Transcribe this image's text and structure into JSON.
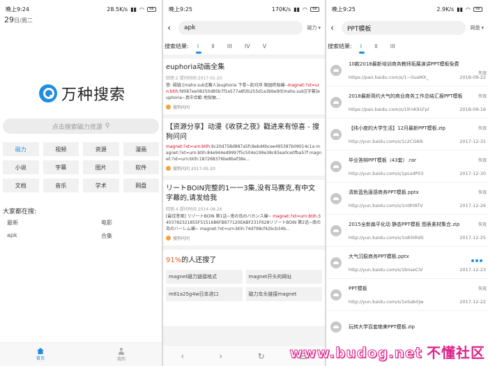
{
  "phone1": {
    "status": {
      "time": "晚上9:24",
      "speed": "28.5K/s",
      "battery": "66"
    },
    "date": {
      "day": "29",
      "weekday": "日/周二"
    },
    "brand": "万种搜索",
    "search_placeholder": "点击搜索磁力资源",
    "categories": [
      "磁力",
      "视频",
      "资源",
      "漫画",
      "小说",
      "字幕",
      "图片",
      "软件",
      "文档",
      "音乐",
      "学术",
      "网盘"
    ],
    "hot_title": "大家都在搜:",
    "hot_items": [
      "最新",
      "电影",
      "apk",
      "合集"
    ],
    "nav": {
      "home": "首页",
      "mine": "我的"
    }
  },
  "phone2": {
    "status": {
      "time": "晚上9:25",
      "speed": "170K/s",
      "battery": "66"
    },
    "query": "apk",
    "engine": "磁力",
    "tabs_label": "搜索结果:",
    "tabs": [
      "I",
      "II",
      "III",
      "IV",
      "V"
    ],
    "results": [
      {
        "title": "euphoria动画全集",
        "meta": "回答:2  提问时间:2017-01-20",
        "snippet_a": "答: 磁链:[maho.sub][魔人]euphoria 下卷~凯刈冲 案园终局编--",
        "snippet_hl": "magnet:?xt=urn:btih:",
        "snippet_b": "fd087ee08250d85b7f1e577a8f2b255d1a3bbe90[maho.sub][字幕]euphoria~真中合歓 地狱抽...",
        "source": "搜狗问问"
      },
      {
        "title": "【资源分享】动漫《收获之夜》戳进来有惊喜 - 搜狗问问",
        "meta": "",
        "snippet_a": "",
        "snippet_hl": "magnet:?xt=urn:btih:",
        "snippet_b": "6c20d758d887a5fc8ebd4bcee495387b09014c1a magnet:?xt=urn:btih:84e944ed9997f5c504e199e38c83ea0ce0fba57f magnet:?xt=urn:btih:187268376be8baf38e...",
        "source": "搜狗问问  2017-05-20"
      },
      {
        "title": "リートBOIN完整的1一一3集,没有马赛克,有中文字幕的,请发给我",
        "meta": "回答:4  提问时间:2014-08-26",
        "snippet_a": "[最佳答案] リゾートBOIN 第1话~南の岛のバカンス编~ ",
        "snippet_hl": "magnet:?xt=urn:btih:",
        "snippet_b": "3403782321855F5151686FB877120EABF231F628リゾートBOIN 第2话~南の岛のハーレム编~ magnet:?xt=urn:btih:74d798cf42bcb34b...",
        "source": "搜狗问问"
      }
    ],
    "others": {
      "percent": "91%",
      "text": "的人还搜了",
      "chips": [
        "magnet磁力链接格式",
        "magnet开头的网址",
        "m81a25g4w日本进口",
        "磁力车头链接magnet"
      ]
    },
    "browser_nav": [
      "‹",
      "›",
      "↻",
      "☰"
    ]
  },
  "phone3": {
    "status": {
      "time": "晚上9:25",
      "speed": "2.9K/s",
      "battery": "66"
    },
    "query": "PPT模板",
    "engine": "网盘",
    "tabs_label": "搜索结果:",
    "tabs": [
      "I",
      "II",
      "III"
    ],
    "items": [
      {
        "title": "10款2018最新培训商务教师拓展演讲PPT模板免费",
        "url": "https://pan.baidu.com/s/1~0uaMX_",
        "date": "2018-09-22",
        "status": "失效"
      },
      {
        "title": "2018最新简约大气的商业商务工作总结汇报PPT模板",
        "url": "https://pan.baidu.com/s/1lFnK91Fpl",
        "date": "2018-09-16",
        "status": "失效"
      },
      {
        "title": "【纬小度的大学生活】12月最新PPT模板.zip",
        "url": "http://yun.baidu.com/s/1c2CG6lk",
        "date": "2017-12-31",
        "status": "失效"
      },
      {
        "title": "毕业答辩PPT模板（43套）.rar",
        "url": "http://yun.baidu.com/s/1pLsdP03",
        "date": "2017-12-30",
        "status": "失效"
      },
      {
        "title": "清新蓝色唐感商务PPT模板.pptx",
        "url": "http://yun.baidu.com/s/1nt8YATV",
        "date": "2017-12-26",
        "status": "失效"
      },
      {
        "title": "2015全新扁平化动 静态PPT模板 图表素材集合.zip",
        "url": "http://yun.baidu.com/s/1o85tRdS",
        "date": "2017-12-25",
        "status": "失效"
      },
      {
        "title": "大气沉稳商务PPT模板.pptx",
        "url": "http://yun.baidu.com/s/1bnseCiV",
        "date": "2017-12-23",
        "status": ""
      },
      {
        "title": "PPT模板",
        "url": "http://yun.baidu.com/s/1eSab0jw",
        "date": "2017-12-22",
        "status": "失效"
      },
      {
        "title": "玩转大学百套绝美PPT模板.zip",
        "url": "",
        "date": "",
        "status": ""
      }
    ]
  },
  "watermark": {
    "a": "www.budog.net",
    "b": "不懂社区"
  }
}
